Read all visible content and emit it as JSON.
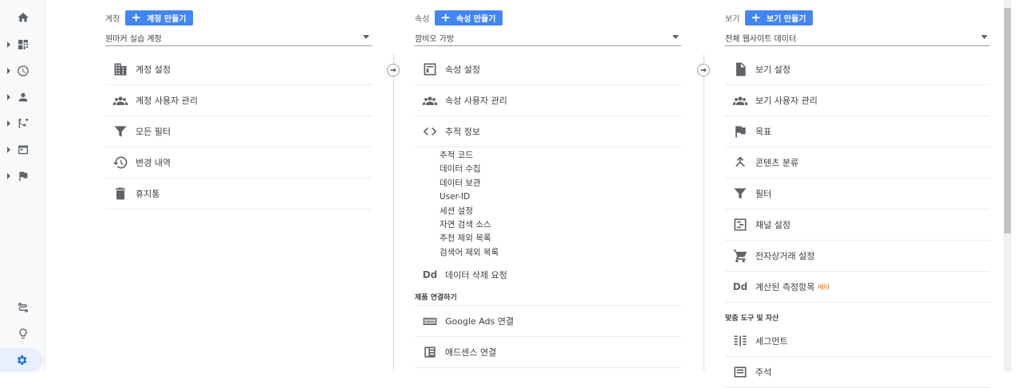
{
  "account": {
    "label": "계정",
    "create_label": "계정 만들기",
    "selected": "원마커 실습 계정",
    "items": [
      {
        "icon": "building-icon",
        "label": "계정 설정"
      },
      {
        "icon": "people-icon",
        "label": "계정 사용자 관리"
      },
      {
        "icon": "filter-icon",
        "label": "모든 필터"
      },
      {
        "icon": "history-icon",
        "label": "변경 내역"
      },
      {
        "icon": "trash-icon",
        "label": "휴지통"
      }
    ]
  },
  "property": {
    "label": "속성",
    "create_label": "속성 만들기",
    "selected": "깜비오 가방",
    "items": [
      {
        "icon": "layout-icon",
        "label": "속성 설정"
      },
      {
        "icon": "people-icon",
        "label": "속성 사용자 관리"
      },
      {
        "icon": "code-icon",
        "label": "추적 정보"
      }
    ],
    "tracking_sub": [
      "추적 코드",
      "데이터 수집",
      "데이터 보관",
      "User-ID",
      "세션 설정",
      "자연 검색 소스",
      "추천 제외 목록",
      "검색어 제외 목록"
    ],
    "delete_request": {
      "icon_text": "Dd",
      "label": "데이터 삭제 요청"
    },
    "product_linking_title": "제품 연결하기",
    "links": [
      {
        "icon": "ads-icon",
        "label": "Google Ads 연결"
      },
      {
        "icon": "adsense-icon",
        "label": "애드센스 연결"
      }
    ]
  },
  "view": {
    "label": "보기",
    "create_label": "보기 만들기",
    "selected": "전체 웹사이트 데이터",
    "items": [
      {
        "icon": "document-icon",
        "label": "보기 설정"
      },
      {
        "icon": "people-icon",
        "label": "보기 사용자 관리"
      },
      {
        "icon": "flag-icon",
        "label": "목표"
      },
      {
        "icon": "content-grouping-icon",
        "label": "콘텐츠 분류"
      },
      {
        "icon": "filter-icon",
        "label": "필터"
      },
      {
        "icon": "channel-icon",
        "label": "채널 설정"
      },
      {
        "icon": "cart-icon",
        "label": "전자상거래 설정"
      }
    ],
    "calculated": {
      "icon_text": "Dd",
      "label": "계산된 측정항목",
      "badge": "베타"
    },
    "personal_tools_title": "맞춤 도구 및 자산",
    "tools": [
      {
        "icon": "segment-icon",
        "label": "세그먼트"
      },
      {
        "icon": "annotation-icon",
        "label": "주석"
      }
    ]
  },
  "nav": [
    "home-icon",
    "dashboard-icon",
    "clock-icon",
    "person-icon",
    "acquisition-icon",
    "behavior-icon",
    "flag-icon",
    "route-icon",
    "lightbulb-icon",
    "gear-icon"
  ],
  "colors": {
    "accent": "#4285f4",
    "beta": "#e8710a",
    "active_nav": "#1a73e8"
  }
}
